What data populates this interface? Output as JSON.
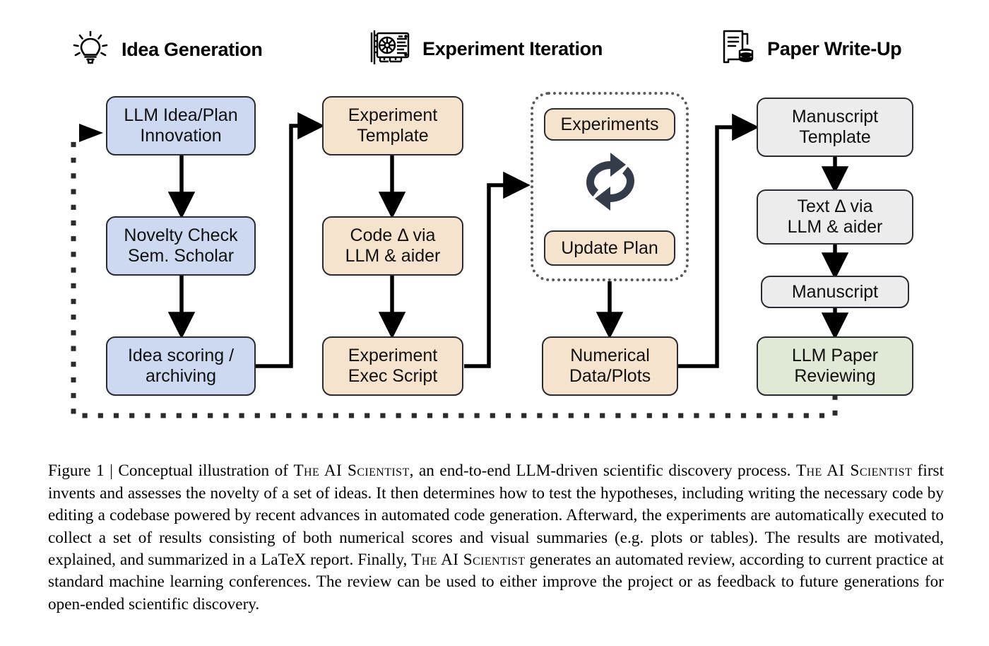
{
  "figure": {
    "stages": [
      {
        "id": "idea-generation",
        "label": "Idea Generation",
        "icon": "lightbulb-icon"
      },
      {
        "id": "experiment-iteration",
        "label": "Experiment Iteration",
        "icon": "gpu-card-icon"
      },
      {
        "id": "paper-write-up",
        "label": "Paper Write-Up",
        "icon": "document-database-icon"
      }
    ],
    "nodes": {
      "llm_idea_plan": "LLM Idea/Plan\nInnovation",
      "novelty_check": "Novelty Check\nSem. Scholar",
      "idea_scoring": "Idea scoring /\narchiving",
      "experiment_template": "Experiment\nTemplate",
      "code_delta": "Code Δ via\nLLM & aider",
      "experiment_exec": "Experiment\nExec Script",
      "experiments": "Experiments",
      "update_plan": "Update Plan",
      "numerical_data": "Numerical\nData/Plots",
      "manuscript_template": "Manuscript\nTemplate",
      "text_delta": "Text Δ via\nLLM & aider",
      "manuscript": "Manuscript",
      "llm_paper_review": "LLM Paper\nReviewing"
    },
    "loop_icon": "refresh-cycle-icon",
    "colors": {
      "blue": "#ccd9f0",
      "beige": "#f6e3cd",
      "gray": "#ececec",
      "green": "#dfe9d6",
      "stroke": "#2b2b33",
      "dotted": "#5a5a5a"
    }
  },
  "caption": {
    "label": "Figure 1",
    "separator": "|",
    "part1": " Conceptual illustration of ",
    "sc1": "The AI Scientist",
    "part2": ", an end-to-end LLM-driven scientific discovery process. ",
    "sc2": "The AI Scientist",
    "part3": " first invents and assesses the novelty of a set of ideas. It then determines how to test the hypotheses, including writing the necessary code by editing a codebase powered by recent advances in automated code generation. Afterward, the experiments are automatically executed to collect a set of results consisting of both numerical scores and visual summaries (e.g. plots or tables). The results are motivated, explained, and summarized in a LaTeX report. Finally, ",
    "sc3": "The AI Scientist",
    "part4": " generates an automated review, according to current practice at standard machine learning conferences. The review can be used to either improve the project or as feedback to future generations for open-ended scientific discovery."
  }
}
